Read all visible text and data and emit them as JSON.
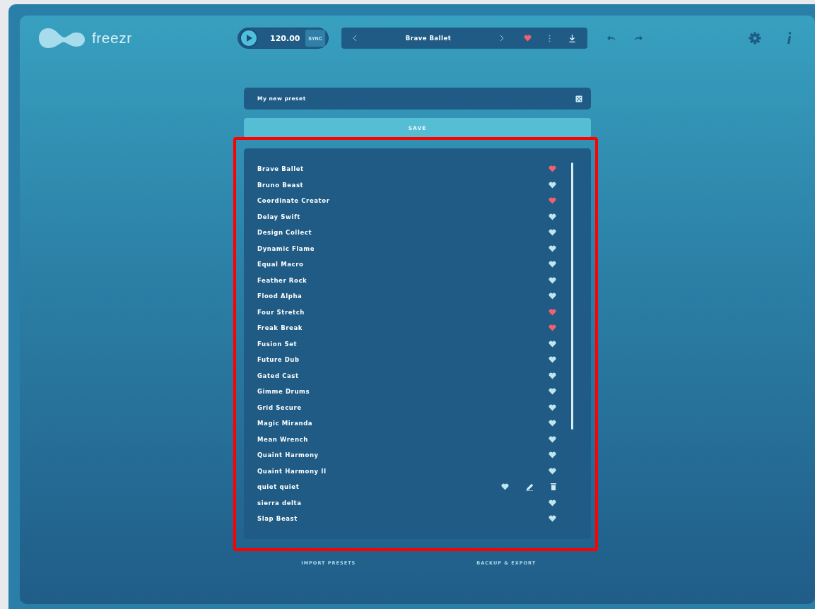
{
  "app": {
    "name": "freezr"
  },
  "transport": {
    "playing": false,
    "tempo": "120.00",
    "sync_label": "SYNC"
  },
  "preset_bar": {
    "name": "Brave Ballet",
    "favorite": true
  },
  "preset_name_field": {
    "value": "My new preset"
  },
  "save_button": "SAVE",
  "presets": [
    {
      "name": "Brave Ballet",
      "favorite": true,
      "hovered": false
    },
    {
      "name": "Bruno Beast",
      "favorite": false,
      "hovered": false
    },
    {
      "name": "Coordinate Creator",
      "favorite": true,
      "hovered": false
    },
    {
      "name": "Delay Swift",
      "favorite": false,
      "hovered": false
    },
    {
      "name": "Design Collect",
      "favorite": false,
      "hovered": false
    },
    {
      "name": "Dynamic Flame",
      "favorite": false,
      "hovered": false
    },
    {
      "name": "Equal Macro",
      "favorite": false,
      "hovered": false
    },
    {
      "name": "Feather Rock",
      "favorite": false,
      "hovered": false
    },
    {
      "name": "Flood Alpha",
      "favorite": false,
      "hovered": false
    },
    {
      "name": "Four Stretch",
      "favorite": true,
      "hovered": false
    },
    {
      "name": "Freak Break",
      "favorite": true,
      "hovered": false
    },
    {
      "name": "Fusion Set",
      "favorite": false,
      "hovered": false
    },
    {
      "name": "Future Dub",
      "favorite": false,
      "hovered": false
    },
    {
      "name": "Gated Cast",
      "favorite": false,
      "hovered": false
    },
    {
      "name": "Gimme Drums",
      "favorite": false,
      "hovered": false
    },
    {
      "name": "Grid Secure",
      "favorite": false,
      "hovered": false
    },
    {
      "name": "Magic Miranda",
      "favorite": false,
      "hovered": false
    },
    {
      "name": "Mean Wrench",
      "favorite": false,
      "hovered": false
    },
    {
      "name": "Quaint Harmony",
      "favorite": false,
      "hovered": false
    },
    {
      "name": "Quaint Harmony II",
      "favorite": false,
      "hovered": false
    },
    {
      "name": "quiet quiet",
      "favorite": false,
      "hovered": true
    },
    {
      "name": "sierra delta",
      "favorite": false,
      "hovered": false
    },
    {
      "name": "Slap Beast",
      "favorite": false,
      "hovered": false
    }
  ],
  "footer_buttons": [
    "IMPORT PRESETS",
    "BACKUP & EXPORT"
  ]
}
